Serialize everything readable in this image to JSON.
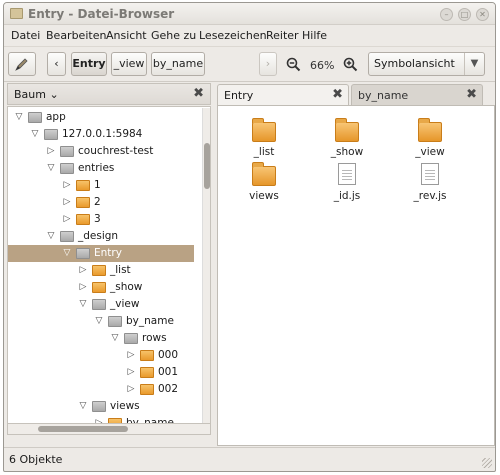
{
  "window": {
    "title": "Entry - Datei-Browser"
  },
  "menu": [
    "Datei",
    "Bearbeiten",
    "Ansicht",
    "Gehe zu",
    "Lesezeichen",
    "Reiter",
    "Hilfe"
  ],
  "toolbar": {
    "path_buttons": [
      "Entry",
      "_view",
      "by_name"
    ],
    "zoom": "66%",
    "view_mode": "Symbolansicht"
  },
  "sidebar": {
    "header": "Baum",
    "tree": [
      {
        "label": "app",
        "icon": "gray"
      },
      {
        "label": "127.0.0.1:5984",
        "icon": "gray"
      },
      {
        "label": "couchrest-test",
        "icon": "gray"
      },
      {
        "label": "entries",
        "icon": "gray"
      },
      {
        "label": "1",
        "icon": "orange"
      },
      {
        "label": "2",
        "icon": "orange"
      },
      {
        "label": "3",
        "icon": "orange"
      },
      {
        "label": "_design",
        "icon": "gray"
      },
      {
        "label": "Entry",
        "icon": "gray",
        "selected": true
      },
      {
        "label": "_list",
        "icon": "orange"
      },
      {
        "label": "_show",
        "icon": "orange"
      },
      {
        "label": "_view",
        "icon": "gray"
      },
      {
        "label": "by_name",
        "icon": "gray"
      },
      {
        "label": "rows",
        "icon": "gray"
      },
      {
        "label": "000",
        "icon": "orange"
      },
      {
        "label": "001",
        "icon": "orange"
      },
      {
        "label": "002",
        "icon": "orange"
      },
      {
        "label": "views",
        "icon": "gray"
      },
      {
        "label": "by_name",
        "icon": "orange"
      }
    ]
  },
  "tabs": [
    {
      "label": "Entry",
      "active": true
    },
    {
      "label": "by_name",
      "active": false
    }
  ],
  "files": [
    {
      "name": "_list",
      "type": "folder"
    },
    {
      "name": "_show",
      "type": "folder"
    },
    {
      "name": "_view",
      "type": "folder"
    },
    {
      "name": "views",
      "type": "folder"
    },
    {
      "name": "_id.js",
      "type": "document"
    },
    {
      "name": "_rev.js",
      "type": "document"
    }
  ],
  "status": {
    "text": "6 Objekte"
  }
}
